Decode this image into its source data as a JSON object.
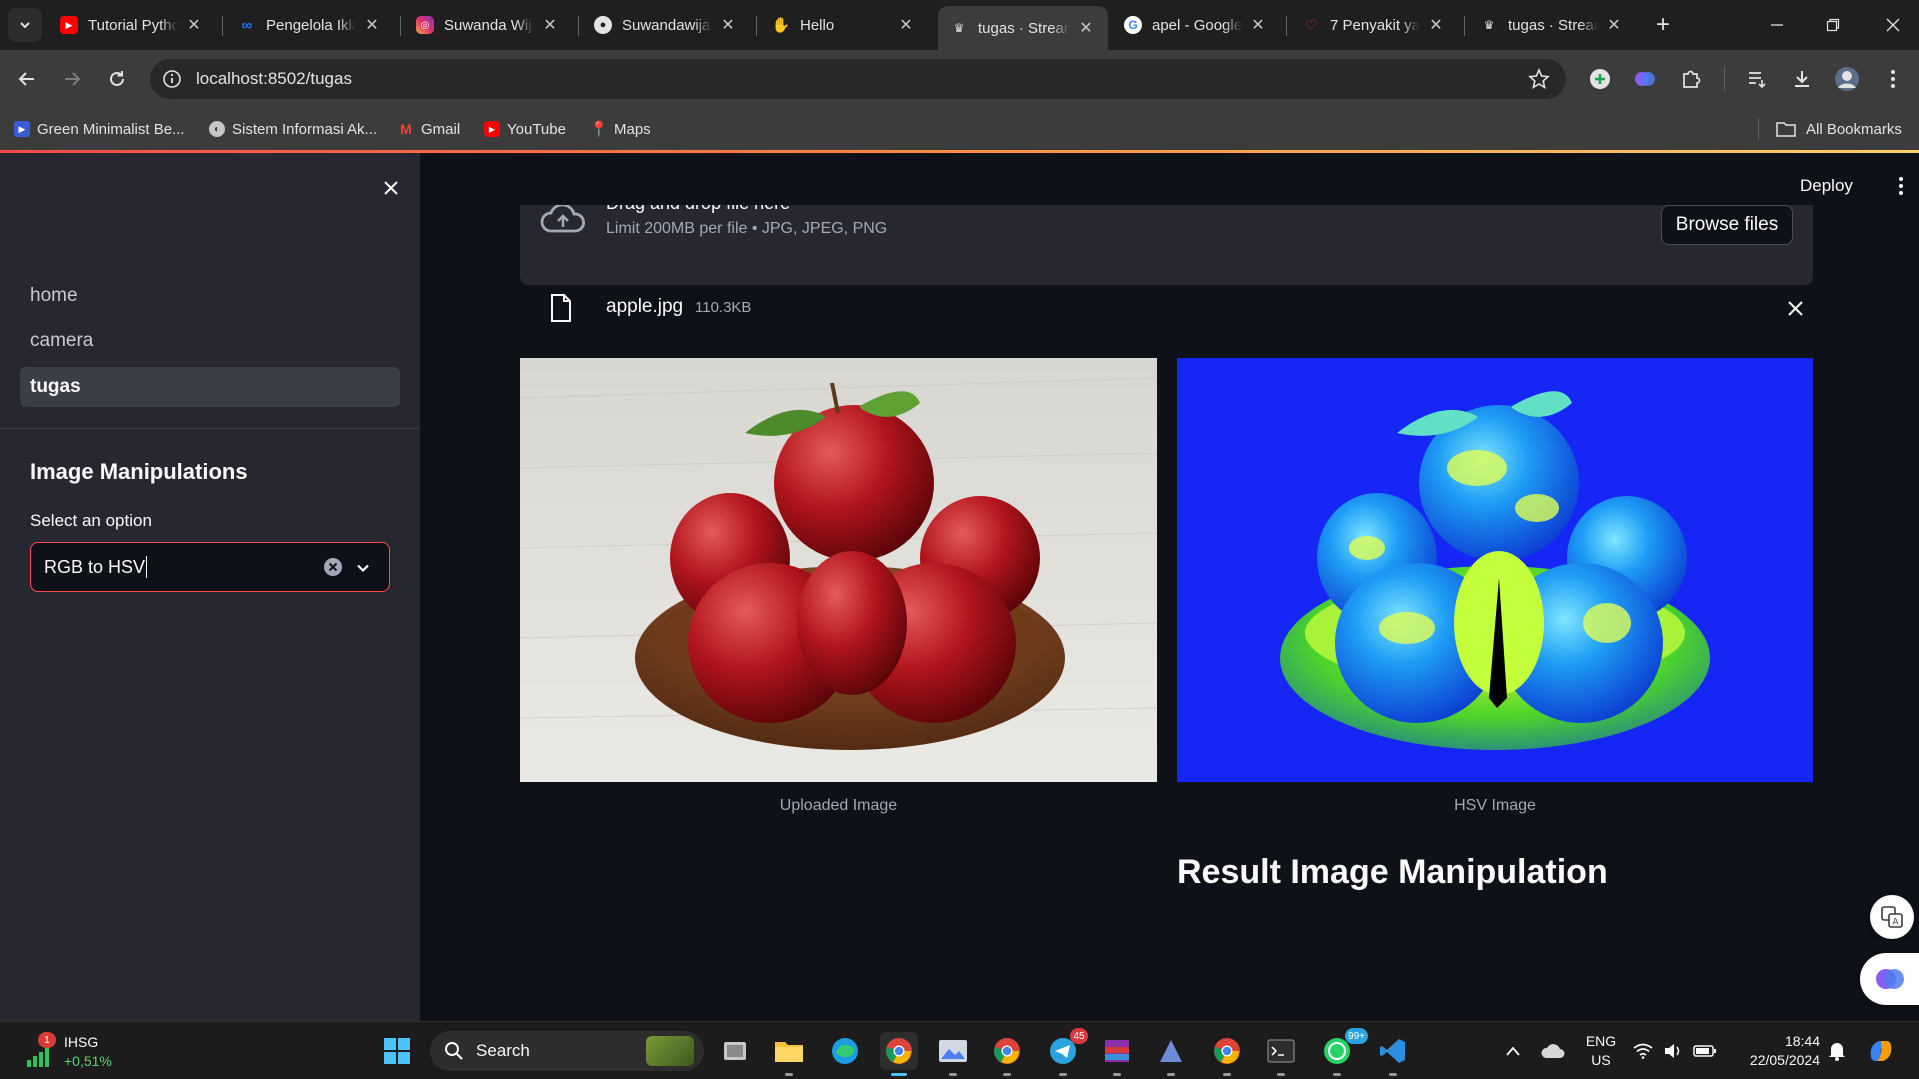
{
  "browser": {
    "tabs": [
      {
        "label": "Tutorial Pytho",
        "icon": "youtube-icon"
      },
      {
        "label": "Pengelola Ikla",
        "icon": "meta-icon"
      },
      {
        "label": "Suwanda Wija",
        "icon": "instagram-icon"
      },
      {
        "label": "Suwandawija",
        "icon": "github-icon"
      },
      {
        "label": "Hello",
        "icon": "wave-hand-icon"
      },
      {
        "label": "tugas · Stream",
        "icon": "streamlit-icon",
        "active": true
      },
      {
        "label": "apel - Google",
        "icon": "google-icon"
      },
      {
        "label": "7 Penyakit ya",
        "icon": "stethoscope-icon"
      },
      {
        "label": "tugas · Stream",
        "icon": "streamlit-icon"
      }
    ],
    "url": "localhost:8502/tugas",
    "bookmarks": [
      {
        "label": "Green Minimalist Be...",
        "icon": "canva-icon"
      },
      {
        "label": "Sistem Informasi Ak...",
        "icon": "globe-icon"
      },
      {
        "label": "Gmail",
        "icon": "gmail-icon"
      },
      {
        "label": "YouTube",
        "icon": "youtube-icon"
      },
      {
        "label": "Maps",
        "icon": "maps-icon"
      }
    ],
    "all_bookmarks_label": "All Bookmarks"
  },
  "app": {
    "deploy_label": "Deploy",
    "nav": [
      {
        "label": "home"
      },
      {
        "label": "camera"
      },
      {
        "label": "tugas",
        "active": true
      }
    ],
    "sidebar_heading": "Image Manipulations",
    "select_label": "Select an option",
    "select_value": "RGB to HSV",
    "uploader": {
      "drop_text": "Drag and drop file here",
      "limit_text": "Limit 200MB per file • JPG, JPEG, PNG",
      "browse_label": "Browse files"
    },
    "file": {
      "name": "apple.jpg",
      "size": "110.3KB"
    },
    "captions": {
      "left": "Uploaded Image",
      "right": "HSV Image"
    },
    "result_heading": "Result Image Manipulation"
  },
  "taskbar": {
    "stock": {
      "name": "IHSG",
      "change": "+0,51%",
      "badge": "1"
    },
    "search_label": "Search",
    "tray": {
      "lang_top": "ENG",
      "lang_bottom": "US",
      "time": "18:44",
      "date": "22/05/2024"
    },
    "badges": {
      "telegram": "45",
      "whatsapp": "99+"
    }
  },
  "colors": {
    "accent": "#ff4b4b",
    "sidebar_bg": "#262730",
    "main_bg": "#0e1117"
  }
}
